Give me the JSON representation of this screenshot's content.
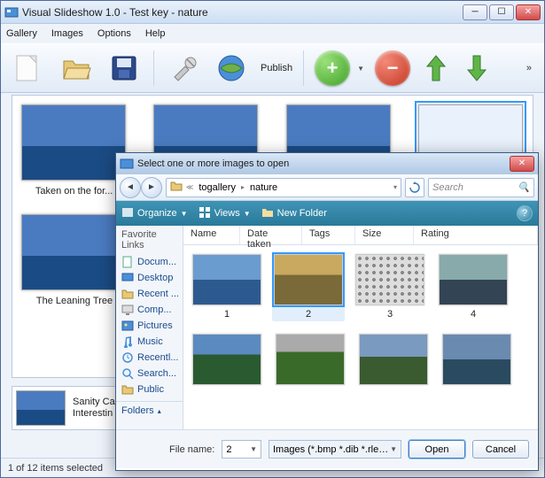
{
  "main": {
    "title": "Visual Slideshow 1.0 - Test key - nature",
    "menu": {
      "gallery": "Gallery",
      "images": "Images",
      "options": "Options",
      "help": "Help"
    },
    "toolbar": {
      "publish": "Publish"
    },
    "thumbs": [
      {
        "caption": "Taken on the for..."
      },
      {
        "caption": ""
      },
      {
        "caption": ""
      },
      {
        "caption": ""
      }
    ],
    "thumbs2": [
      {
        "caption": "The Leaning Tree"
      }
    ],
    "detail": {
      "line1": "Sanity Ca",
      "line2": "Interestin"
    },
    "status": {
      "selected": "1 of 12 items selected"
    }
  },
  "dialog": {
    "title": "Select one or more images to open",
    "breadcrumb": {
      "seg1": "togallery",
      "seg2": "nature"
    },
    "search_placeholder": "Search",
    "cmdbar": {
      "organize": "Organize",
      "views": "Views",
      "newfolder": "New Folder"
    },
    "fav_header": "Favorite Links",
    "fav": {
      "documents": "Docum...",
      "desktop": "Desktop",
      "recentp": "Recent ...",
      "computer": "Comp...",
      "pictures": "Pictures",
      "music": "Music",
      "recently": "Recentl...",
      "searches": "Search...",
      "public": "Public"
    },
    "folders_label": "Folders",
    "columns": {
      "name": "Name",
      "date": "Date taken",
      "tags": "Tags",
      "size": "Size",
      "rating": "Rating"
    },
    "files": [
      {
        "label": "1"
      },
      {
        "label": "2"
      },
      {
        "label": "3"
      },
      {
        "label": "4"
      }
    ],
    "filename_label": "File name:",
    "filename_value": "2",
    "filter": "Images (*.bmp *.dib *.rle *.jpg *",
    "open": "Open",
    "cancel": "Cancel"
  }
}
